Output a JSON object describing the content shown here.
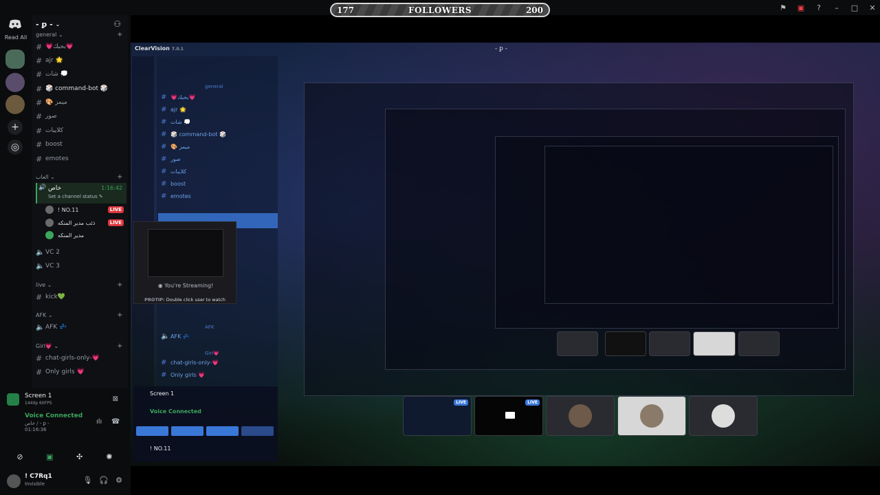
{
  "followers": {
    "current": "177",
    "label": "FOLLOWERS",
    "goal": "200"
  },
  "rail": {
    "read_all": "Read All"
  },
  "guild": {
    "name": "- ꝑ -"
  },
  "categories": {
    "general": "general",
    "games": "العاب",
    "live": "live",
    "afk": "AFK",
    "girl": "Girl💗"
  },
  "text_channels": [
    {
      "label": "💗بحبك💗"
    },
    {
      "label": "ajr 🌟"
    },
    {
      "label": "شات 💭"
    },
    {
      "label": "🎲 command-bot 🎲"
    },
    {
      "label": "🎨 ميمز"
    },
    {
      "label": "صور"
    },
    {
      "label": "كلايبات"
    },
    {
      "label": "boost"
    },
    {
      "label": "emotes"
    }
  ],
  "voice_channel": {
    "label": "خاص",
    "time": "1:16:42",
    "status": "Set a channel status ✎"
  },
  "voice_users": [
    {
      "name": "! NO.11",
      "live": "LIVE"
    },
    {
      "name": "ذئب مدير المنكه",
      "live": "LIVE"
    },
    {
      "name": "مدير المنكه",
      "live": ""
    }
  ],
  "other_voice": [
    {
      "label": "VC 2"
    },
    {
      "label": "VC 3"
    }
  ],
  "live_channels": [
    {
      "label": "kick💚"
    }
  ],
  "afk_channels": [
    {
      "label": "AFK 💤"
    }
  ],
  "girl_channels": [
    {
      "label": "chat-girls-only-💗"
    },
    {
      "label": "Only girls 💗"
    }
  ],
  "panel": {
    "screen_name": "Screen 1",
    "screen_sub": "1440p 60FPS",
    "voice_connected": "Voice Connected",
    "voice_location": "خاص / - ꝑ -",
    "voice_time": "01:16:36",
    "user_name": "! C7Rq1",
    "user_status": "Invisible"
  },
  "stream": {
    "app_title": "ClearVision",
    "app_version": "7.0.1",
    "guild": "- ꝑ -",
    "streaming_text": "You're Streaming!",
    "protip_label": "PROTIP:",
    "protip_text": "Double click user to watch",
    "inner_screen": "Screen 1",
    "inner_voice": "Voice Connected",
    "inner_user": "! NO.11",
    "tile_live": "LIVE"
  }
}
